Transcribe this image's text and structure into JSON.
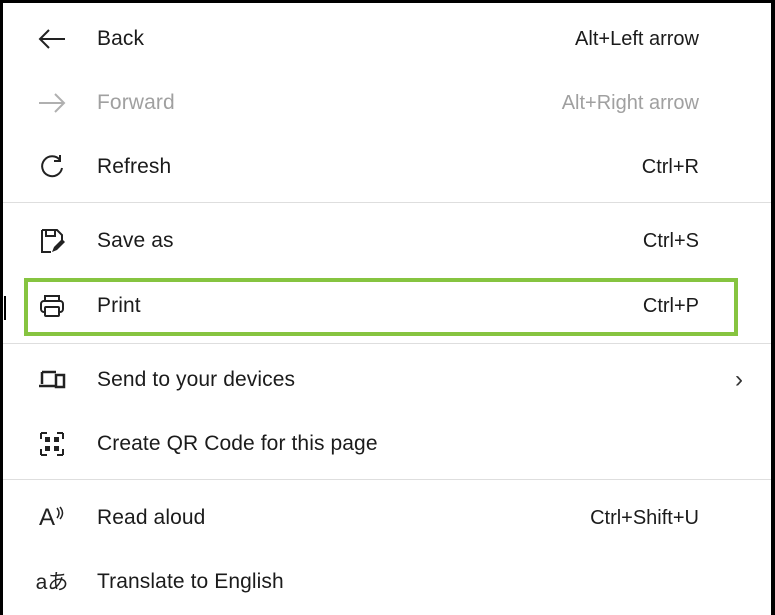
{
  "menu": {
    "items": [
      {
        "label": "Back",
        "shortcut": "Alt+Left arrow",
        "icon": "arrow-left-icon",
        "disabled": false
      },
      {
        "label": "Forward",
        "shortcut": "Alt+Right arrow",
        "icon": "arrow-right-icon",
        "disabled": true
      },
      {
        "label": "Refresh",
        "shortcut": "Ctrl+R",
        "icon": "refresh-icon",
        "disabled": false
      },
      {
        "label": "Save as",
        "shortcut": "Ctrl+S",
        "icon": "save-as-icon",
        "disabled": false
      },
      {
        "label": "Print",
        "shortcut": "Ctrl+P",
        "icon": "printer-icon",
        "disabled": false,
        "highlighted": true
      },
      {
        "label": "Send to your devices",
        "shortcut": "",
        "icon": "devices-icon",
        "disabled": false,
        "submenu": true
      },
      {
        "label": "Create QR Code for this page",
        "shortcut": "",
        "icon": "qr-code-icon",
        "disabled": false
      },
      {
        "label": "Read aloud",
        "shortcut": "Ctrl+Shift+U",
        "icon": "read-aloud-icon",
        "disabled": false
      },
      {
        "label": "Translate to English",
        "shortcut": "",
        "icon": "translate-icon",
        "disabled": false
      }
    ],
    "icon_text": {
      "read_aloud": "A",
      "translate": "aあ"
    }
  },
  "colors": {
    "highlight": "#86c440",
    "disabled_text": "#a0a0a0",
    "separator": "#dedede"
  }
}
